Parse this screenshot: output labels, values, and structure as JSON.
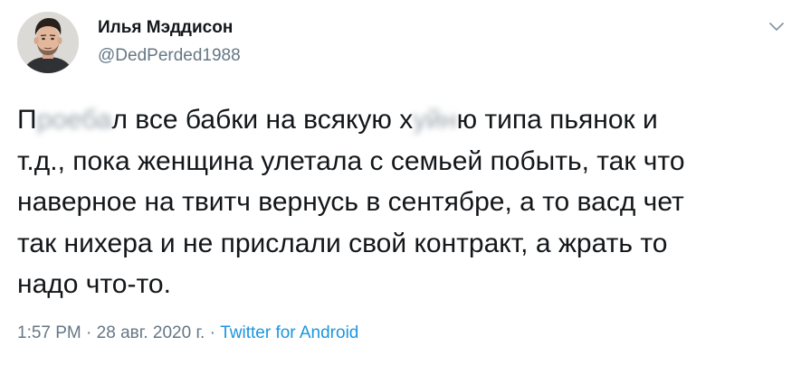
{
  "author": {
    "display_name": "Илья Мэддисон",
    "handle": "@DedPerded1988"
  },
  "tweet": {
    "lines": [
      {
        "a": "П",
        "censored": "роеба",
        "b": "л все бабки на всякую х",
        "censored2": "уйн",
        "c": "ю типа пьянок и"
      },
      "т.д., пока женщина улетала с семьей побыть, так что",
      "наверное на твитч вернусь в сентябре, а то васд чет",
      "так нихера и не прислали свой контракт, а жрать то",
      "надо что-то."
    ]
  },
  "meta": {
    "time": "1:57 PM",
    "sep1": " · ",
    "date": "28 авг. 2020 г.",
    "sep2": " · ",
    "source": "Twitter for Android"
  },
  "icons": {
    "menu": "chevron-down-icon",
    "avatar": "avatar"
  },
  "colors": {
    "text": "#14171a",
    "secondary": "#657786",
    "link": "#1b95e0"
  }
}
